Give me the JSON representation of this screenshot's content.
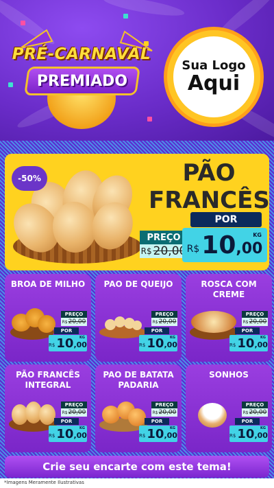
{
  "header": {
    "badge_title": "PRÉ-CARNAVAL",
    "badge_subtitle": "PREMIADO",
    "logo_line1": "Sua Logo",
    "logo_line2": "Aqui"
  },
  "hero": {
    "discount": "-50%",
    "title_line1": "PÃO",
    "title_line2": "FRANCÊS",
    "preco_label": "PREÇO",
    "old_currency": "R$",
    "old_price": "20,00",
    "por_label": "POR",
    "currency": "R$",
    "price_int": "10",
    "price_cents": ",00",
    "unit": "KG"
  },
  "products": [
    {
      "title": "BROA DE MILHO",
      "preco_label": "PREÇO",
      "old_currency": "R$",
      "old_price": "20,00",
      "por_label": "POR",
      "currency": "R$",
      "price_int": "10",
      "price_cents": ",00",
      "unit": "KG"
    },
    {
      "title": "PAO DE QUEIJO",
      "preco_label": "PREÇO",
      "old_currency": "R$",
      "old_price": "20,00",
      "por_label": "POR",
      "currency": "R$",
      "price_int": "10",
      "price_cents": ",00",
      "unit": "KG"
    },
    {
      "title": "ROSCA COM CREME",
      "preco_label": "PREÇO",
      "old_currency": "R$",
      "old_price": "20,00",
      "por_label": "POR",
      "currency": "R$",
      "price_int": "10",
      "price_cents": ",00",
      "unit": "KG"
    },
    {
      "title": "PÃO FRANCÊS INTEGRAL",
      "preco_label": "PREÇO",
      "old_currency": "R$",
      "old_price": "20,00",
      "por_label": "POR",
      "currency": "R$",
      "price_int": "10",
      "price_cents": ",00",
      "unit": "KG"
    },
    {
      "title": "PAO DE BATATA PADARIA",
      "preco_label": "PREÇO",
      "old_currency": "R$",
      "old_price": "20,00",
      "por_label": "POR",
      "currency": "R$",
      "price_int": "10",
      "price_cents": ",00",
      "unit": "KG"
    },
    {
      "title": "SONHOS",
      "preco_label": "PREÇO",
      "old_currency": "R$",
      "old_price": "20,00",
      "por_label": "POR",
      "currency": "R$",
      "price_int": "10",
      "price_cents": ",00",
      "unit": "KG"
    }
  ],
  "cta": "Crie seu encarte com este tema!",
  "footer_note": "*Imagens Meramente Ilustrativas",
  "colors": {
    "purple": "#7a26c8",
    "yellow": "#ffd21f",
    "cyan": "#42d3e6",
    "navy": "#0b2a5c"
  }
}
